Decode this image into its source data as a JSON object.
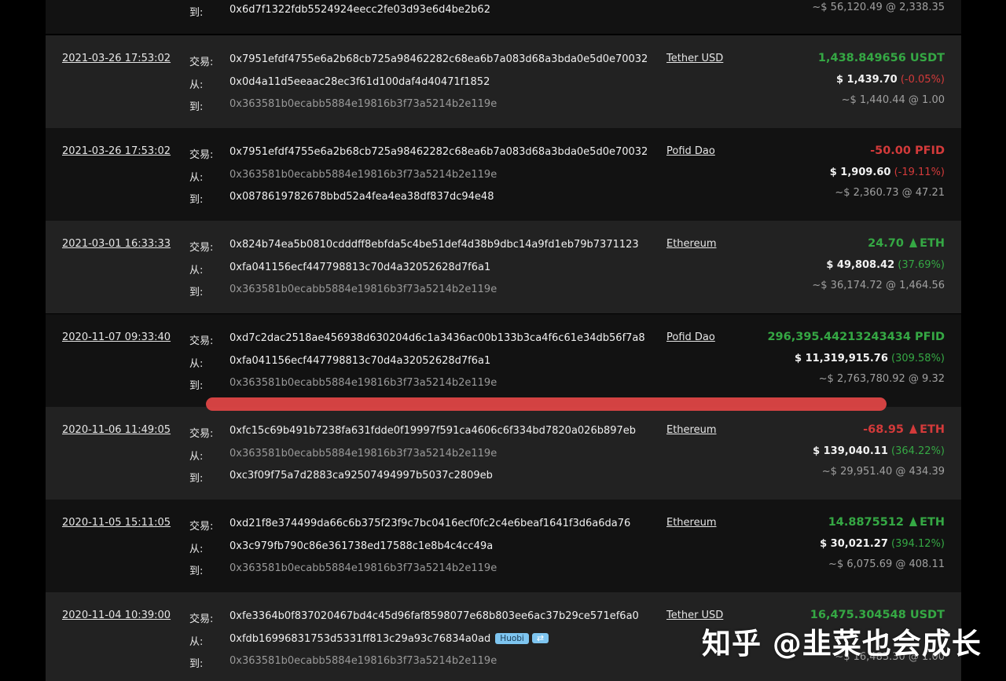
{
  "labels": {
    "tx": "交易:",
    "from": "从:",
    "to": "到:"
  },
  "colors": {
    "positive": "#35a844",
    "negative": "#d33a3a",
    "badge": "#7ec5f0",
    "highlight": "#e24646"
  },
  "top_partial": {
    "to": "0x6d7f1322fdb5524924eecc2fe03d93e6d4be2b62",
    "approx": "~$ 56,120.49 @ 2,338.35"
  },
  "rows": [
    {
      "date": "2021-03-26 17:53:02",
      "tx": "0x7951efdf4755e6a2b68cb725a98462282c68ea6b7a083d68a3bda0e5d0e70032",
      "from": "0x0d4a11d5eeaac28ec3f61d100daf4d40471f1852",
      "to": "0x363581b0ecabb5884e19816b3f73a5214b2e119e",
      "token": "Tether USD",
      "amount": "1,438.849656 USDT",
      "usd": "$ 1,439.70",
      "pct": "(-0.05%)",
      "approx": "~$ 1,440.44 @ 1.00"
    },
    {
      "date": "2021-03-26 17:53:02",
      "tx": "0x7951efdf4755e6a2b68cb725a98462282c68ea6b7a083d68a3bda0e5d0e70032",
      "from": "0x363581b0ecabb5884e19816b3f73a5214b2e119e",
      "to": "0x0878619782678bbd52a4fea4ea38df837dc94e48",
      "token": "Pofid Dao",
      "amount": "-50.00 PFID",
      "usd": "$ 1,909.60",
      "pct": "(-19.11%)",
      "approx": "~$ 2,360.73 @ 47.21"
    },
    {
      "date": "2021-03-01 16:33:33",
      "tx": "0x824b74ea5b0810cdddff8ebfda5c4be51def4d38b9dbc14a9fd1eb79b7371123",
      "from": "0xfa041156ecf447798813c70d4a32052628d7f6a1",
      "to": "0x363581b0ecabb5884e19816b3f73a5214b2e119e",
      "token": "Ethereum",
      "amount_num": "24.70",
      "amount_unit": "ETH",
      "usd": "$ 49,808.42",
      "pct": "(37.69%)",
      "approx": "~$ 36,174.72 @ 1,464.56"
    },
    {
      "date": "2020-11-07 09:33:40",
      "tx": "0xd7c2dac2518ae456938d630204d6c1a3436ac00b133b3ca4f6c61e34db56f7a8",
      "from": "0xfa041156ecf447798813c70d4a32052628d7f6a1",
      "to": "0x363581b0ecabb5884e19816b3f73a5214b2e119e",
      "token": "Pofid Dao",
      "amount": "296,395.44213243434 PFID",
      "usd": "$ 11,319,915.76",
      "pct": "(309.58%)",
      "approx": "~$ 2,763,780.92 @ 9.32"
    },
    {
      "date": "2020-11-06 11:49:05",
      "tx": "0xfc15c69b491b7238fa631fdde0f19997f591ca4606c6f334bd7820a026b897eb",
      "from": "0x363581b0ecabb5884e19816b3f73a5214b2e119e",
      "to": "0xc3f09f75a7d2883ca92507494997b5037c2809eb",
      "token": "Ethereum",
      "amount_num": "-68.95",
      "amount_unit": "ETH",
      "usd": "$ 139,040.11",
      "pct": "(364.22%)",
      "approx": "~$ 29,951.40 @ 434.39"
    },
    {
      "date": "2020-11-05 15:11:05",
      "tx": "0xd21f8e374499da66c6b375f23f9c7bc0416ecf0fc2c4e6beaf1641f3d6a6da76",
      "from": "0x3c979fb790c86e361738ed17588c1e8b4c4cc49a",
      "to": "0x363581b0ecabb5884e19816b3f73a5214b2e119e",
      "token": "Ethereum",
      "amount_num": "14.8875512",
      "amount_unit": "ETH",
      "usd": "$ 30,021.27",
      "pct": "(394.12%)",
      "approx": "~$ 6,075.69 @ 408.11"
    },
    {
      "date": "2020-11-04 10:39:00",
      "tx": "0xfe3364b0f837020467bd4c45d96faf8598077e68b803ee6ac37b29ce571ef6a0",
      "from": "0xfdb16996831753d5331ff813c29a93c76834a0ad",
      "from_badge": "Huobi",
      "from_swap": "⇄",
      "to": "0x363581b0ecabb5884e19816b3f73a5214b2e119e",
      "token": "Tether USD",
      "amount": "16,475.304548 USDT",
      "approx": "~$ 16,483.30 @ 1.00"
    }
  ],
  "watermark": "知乎 @韭菜也会成长"
}
